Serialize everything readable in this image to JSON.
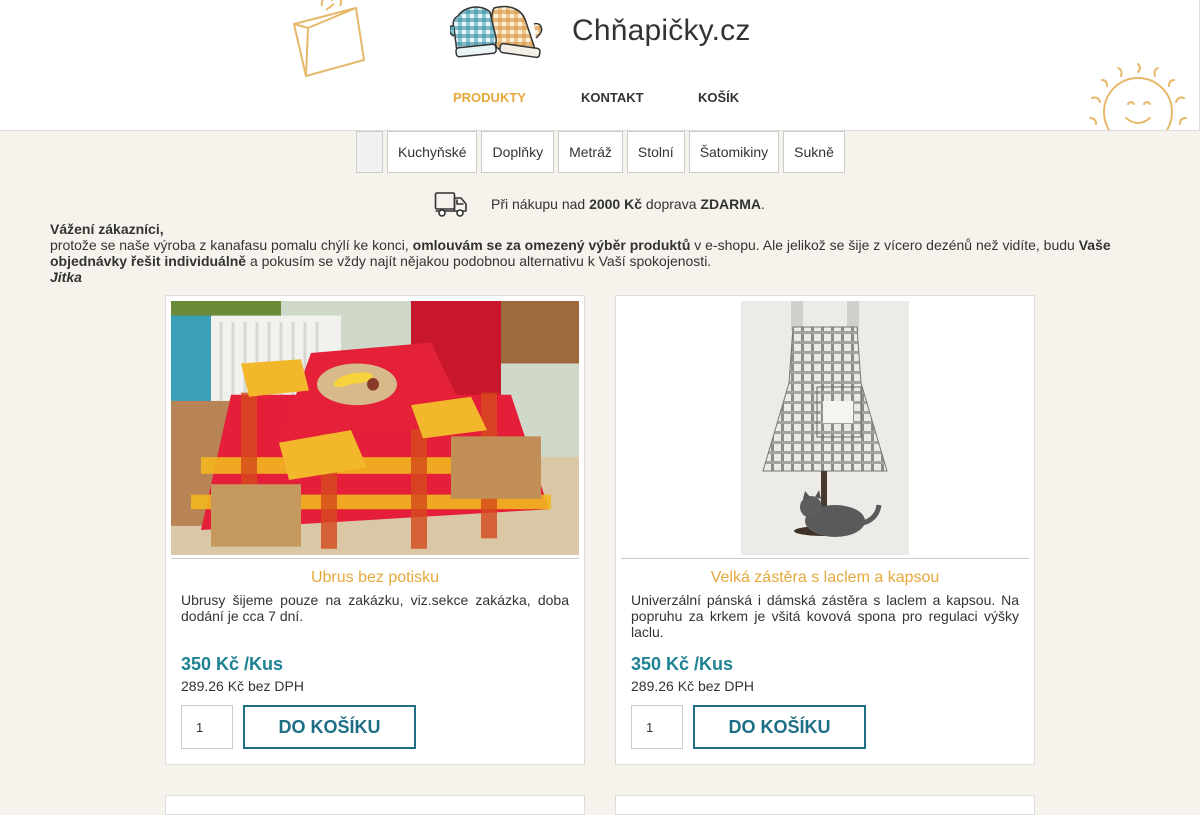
{
  "header": {
    "title": "Chňapičky.cz",
    "nav": [
      {
        "label": "PRODUKTY",
        "icon": "box-icon",
        "active": true
      },
      {
        "label": "KONTAKT",
        "icon": "mail-icon",
        "active": false
      },
      {
        "label": "KOŠÍK",
        "icon": "cart-icon",
        "active": false
      }
    ]
  },
  "categories": {
    "home_icon": "",
    "items": [
      "Kuchyňské",
      "Doplňky",
      "Metráž",
      "Stolní",
      "Šatomikiny",
      "Sukně"
    ]
  },
  "shipping": {
    "prefix": "Při nákupu nad ",
    "amount": "2000 Kč",
    "middle": " doprava ",
    "free": "ZDARMA",
    "suffix": "."
  },
  "notice": {
    "greeting": "Vážení zákazníci,",
    "part1": "protože se naše výroba z kanafasu pomalu chýlí ke konci, ",
    "bold1": "omlouvám se za omezený výběr produktů",
    "part2": " v e-shopu. Ale jelikož se šije z vícero dezénů než vidíte, budu ",
    "bold2": "Vaše objednávky řešit individuálně",
    "part3": " a pokusím se vždy najít nějakou podobnou alternativu k Vaší spokojenosti.",
    "signature": "Jitka"
  },
  "products": [
    {
      "name": "Ubrus bez potisku",
      "description": "Ubrusy šijeme pouze na zakázku, viz.sekce zakázka, doba dodání je cca 7 dní.",
      "price": "350 Kč /Kus",
      "price_net": "289.26 Kč bez DPH",
      "qty": "1",
      "button": "DO KOŠÍKU",
      "button_icon": ""
    },
    {
      "name": "Velká zástěra s laclem a kapsou",
      "description": "Univerzální pánská i dámská zástěra s laclem a kapsou. Na popruhu za krkem je všitá kovová spona pro regulaci výšky laclu.",
      "price": "350 Kč /Kus",
      "price_net": "289.26 Kč bez DPH",
      "qty": "1",
      "button": "DO KOŠÍKU",
      "button_icon": ""
    }
  ],
  "colors": {
    "accent": "#e6a83b",
    "price": "#1e8294",
    "button": "#1e6f86",
    "background": "#f6f3ed"
  }
}
